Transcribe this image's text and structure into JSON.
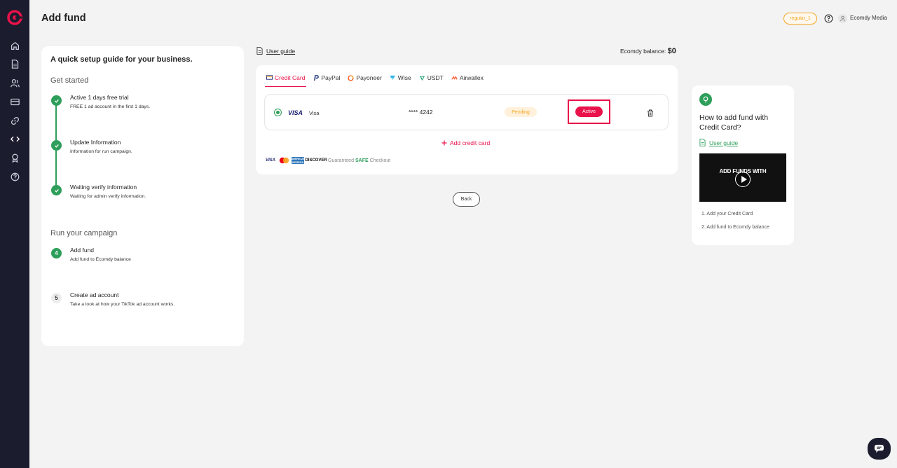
{
  "header": {
    "title": "Add fund",
    "badge": "regular_1",
    "user_name": "Ecomdy Media"
  },
  "sidebar": {
    "items": [
      {
        "icon": "home-icon"
      },
      {
        "icon": "document-icon"
      },
      {
        "icon": "users-icon"
      },
      {
        "icon": "card-icon"
      },
      {
        "icon": "link-icon"
      },
      {
        "icon": "code-icon"
      },
      {
        "icon": "award-icon"
      },
      {
        "icon": "help-icon"
      }
    ]
  },
  "guide": {
    "title": "A quick setup guide for your business.",
    "get_started": "Get started",
    "run_campaign": "Run your campaign",
    "steps": [
      {
        "title": "Active 1 days free trial",
        "desc": "FREE 1 ad account in the first 1 days.",
        "status": "done"
      },
      {
        "title": "Update Information",
        "desc": "Information for run campaign.",
        "status": "done"
      },
      {
        "title": "Waiting verify information",
        "desc": "Waiting for admin verify information.",
        "status": "done"
      },
      {
        "number": "4",
        "title": "Add fund",
        "desc": "Add fund to Ecomdy balance",
        "status": "current"
      },
      {
        "number": "5",
        "title": "Create ad account",
        "desc": "Take a look at how your TikTok ad account works.",
        "status": "todo"
      }
    ]
  },
  "main": {
    "user_guide": "User guide",
    "balance_label": "Ecomdy balance:",
    "balance_value": "$0",
    "tabs": [
      {
        "label": "Credit Card",
        "active": true
      },
      {
        "label": "PayPal"
      },
      {
        "label": "Payoneer"
      },
      {
        "label": "Wise"
      },
      {
        "label": "USDT"
      },
      {
        "label": "Airwallex"
      }
    ],
    "card": {
      "brand_logo": "VISA",
      "brand": "Visa",
      "number": "**** 4242",
      "status": "Pending",
      "action": "Active"
    },
    "add_card": "Add credit card",
    "checkout": {
      "visa": "VISA",
      "amex": "AMERICAN EXPRESS",
      "discover": "DISCOVER",
      "guaranteed": "Guaranteed",
      "safe": "SAFE",
      "checkout": "Checkout"
    },
    "back": "Back"
  },
  "help": {
    "title": "How to add fund with Credit Card?",
    "user_guide": "User guide",
    "video_text": "ADD FUNDS WITH",
    "steps": [
      "1. Add your Credit Card",
      "2. Add fund to Ecomdy balance"
    ]
  },
  "colors": {
    "accent": "#e9124a",
    "success": "#2e9e5b",
    "warning": "#f5a623",
    "sidebar": "#1b1c2e"
  }
}
